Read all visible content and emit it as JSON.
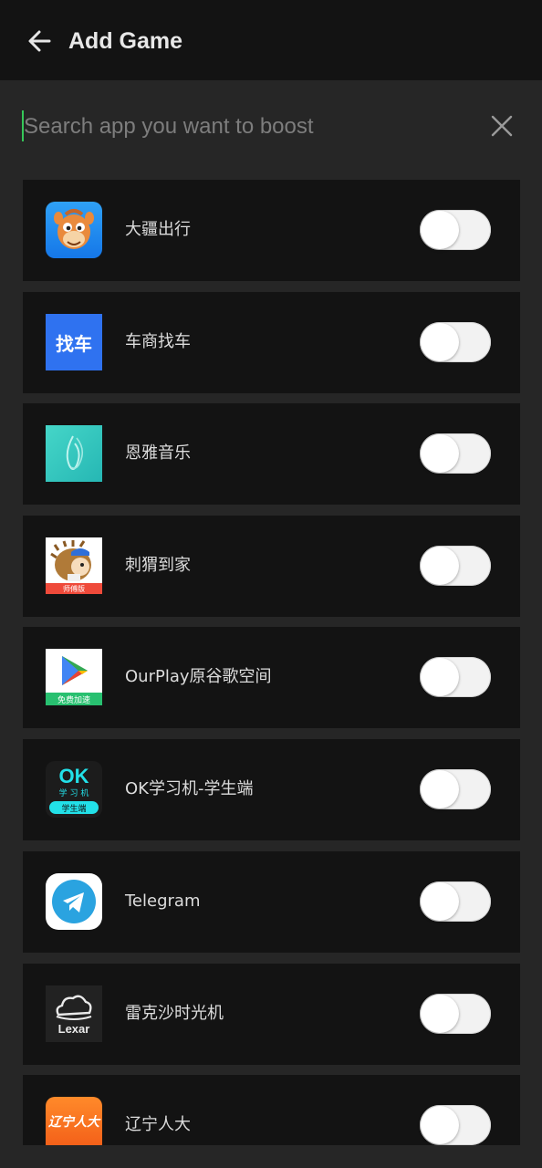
{
  "header": {
    "title": "Add Game",
    "back_icon": "arrow-left-icon"
  },
  "search": {
    "placeholder": "Search app you want to boost",
    "value": "",
    "clear_icon": "close-icon",
    "caret_color": "#35c759"
  },
  "apps": [
    {
      "name": "大疆出行",
      "icon": "camel-mascot-icon",
      "enabled": false,
      "icon_text": ""
    },
    {
      "name": "车商找车",
      "icon": "zhaoche-logo-icon",
      "enabled": false,
      "icon_text": "找车"
    },
    {
      "name": "恩雅音乐",
      "icon": "music-wave-icon",
      "enabled": false,
      "icon_text": ""
    },
    {
      "name": "刺猬到家",
      "icon": "hedgehog-mascot-icon",
      "enabled": false,
      "icon_text": "师傅版"
    },
    {
      "name": "OurPlay原谷歌空间",
      "icon": "play-triangle-icon",
      "enabled": false,
      "icon_text": "免费加速"
    },
    {
      "name": "OK学习机-学生端",
      "icon": "ok-logo-icon",
      "enabled": false,
      "icon_text": "OK",
      "icon_text2": "学 习 机",
      "icon_text3": "学生端"
    },
    {
      "name": "Telegram",
      "icon": "telegram-plane-icon",
      "enabled": false,
      "icon_text": ""
    },
    {
      "name": "雷克沙时光机",
      "icon": "lexar-cloud-icon",
      "enabled": false,
      "icon_text": "Lexar"
    },
    {
      "name": "辽宁人大",
      "icon": "liaoning-logo-icon",
      "enabled": false,
      "icon_text": "辽宁人大"
    }
  ],
  "colors": {
    "background": "#262626",
    "row": "#131313",
    "text": "#dcdcdc",
    "toggle_off": "#f2f2f2"
  }
}
